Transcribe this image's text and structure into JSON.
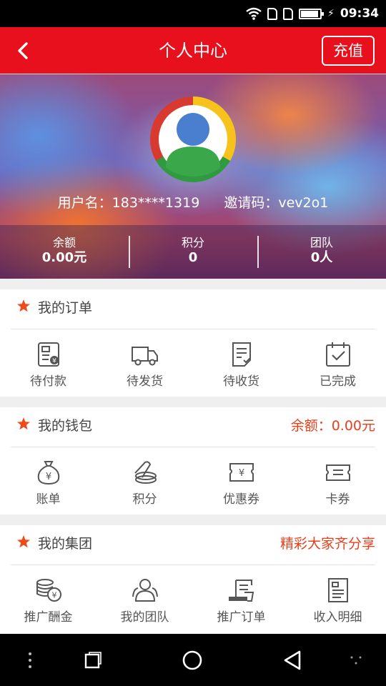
{
  "status_bar": {
    "time": "09:34"
  },
  "header": {
    "title": "个人中心",
    "recharge_label": "充值"
  },
  "profile": {
    "username_text": "用户名：183****1319",
    "invite_text": "邀请码：vev2o1",
    "stats": [
      {
        "label": "余额",
        "value": "0.00元"
      },
      {
        "label": "积分",
        "value": "0"
      },
      {
        "label": "团队",
        "value": "0人"
      }
    ]
  },
  "orders": {
    "title": "我的订单",
    "items": [
      {
        "label": "待付款",
        "icon": "pending-payment-icon"
      },
      {
        "label": "待发货",
        "icon": "truck-icon"
      },
      {
        "label": "待收货",
        "icon": "receive-doc-icon"
      },
      {
        "label": "已完成",
        "icon": "calendar-check-icon"
      }
    ]
  },
  "wallet": {
    "title": "我的钱包",
    "balance_text": "余额：0.00元",
    "items": [
      {
        "label": "账单",
        "icon": "money-bag-icon"
      },
      {
        "label": "积分",
        "icon": "coins-icon"
      },
      {
        "label": "优惠券",
        "icon": "coupon-icon"
      },
      {
        "label": "卡券",
        "icon": "voucher-icon"
      }
    ]
  },
  "group": {
    "title": "我的集团",
    "slogan": "精彩大家齐分享",
    "items": [
      {
        "label": "推广酬金",
        "icon": "coin-stack-icon"
      },
      {
        "label": "我的团队",
        "icon": "team-icon"
      },
      {
        "label": "推广订单",
        "icon": "promo-order-icon"
      },
      {
        "label": "收入明细",
        "icon": "income-detail-icon"
      }
    ]
  },
  "colors": {
    "primary_red": "#e8101c",
    "accent_orange": "#e8401c",
    "icon_gray": "#555555"
  }
}
